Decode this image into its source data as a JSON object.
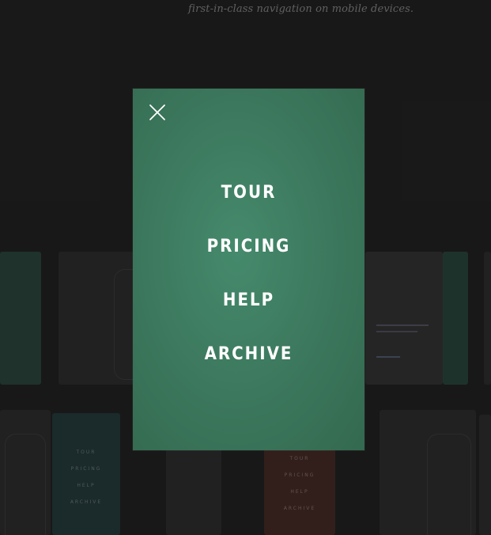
{
  "page": {
    "tagline": "first-in-class navigation on mobile devices."
  },
  "background": {
    "preview_a_lines": [
      "TOUR",
      "PRICING",
      "HELP",
      "ARCHIVE"
    ],
    "preview_b_lines": [
      "TOUR",
      "PRICING",
      "HELP",
      "ARCHIVE"
    ]
  },
  "menu": {
    "close_icon": "close-x-icon",
    "items": [
      {
        "label": "TOUR"
      },
      {
        "label": "PRICING"
      },
      {
        "label": "HELP"
      },
      {
        "label": "ARCHIVE"
      }
    ]
  },
  "colors": {
    "page_background": "#1c1c1c",
    "menu_green": "#3d7a5f",
    "menu_text": "#ffffff"
  }
}
